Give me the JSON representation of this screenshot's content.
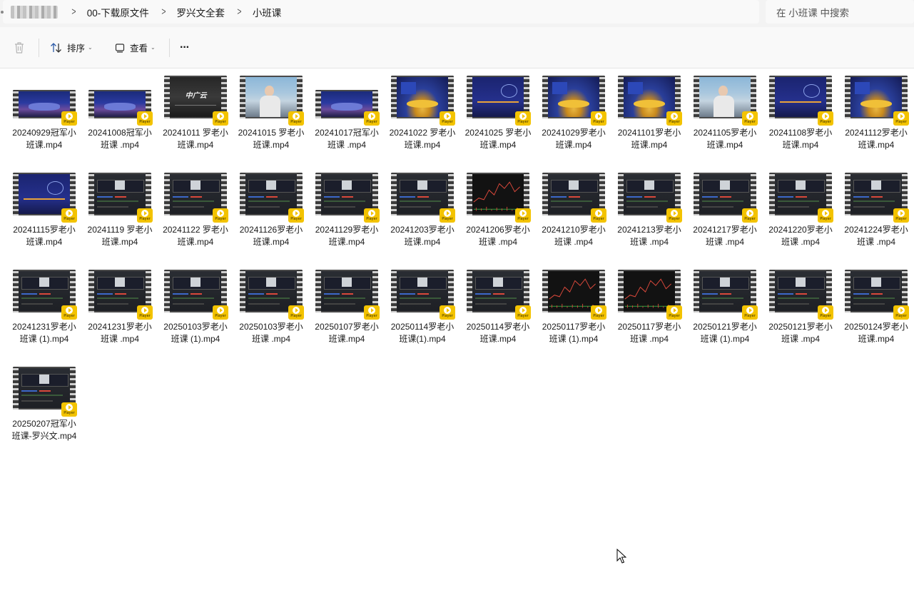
{
  "breadcrumb": {
    "items": [
      "00-下载原文件",
      "罗兴文全套",
      "小班课"
    ]
  },
  "search": {
    "placeholder": "在 小班课 中搜索"
  },
  "toolbar": {
    "sort_label": "排序",
    "view_label": "查看",
    "more_label": "···"
  },
  "badge_label": "Player",
  "files": [
    {
      "name": "20240929冠军小班课.mp4",
      "thumb": "stage"
    },
    {
      "name": "20241008冠军小班课 .mp4",
      "thumb": "stage"
    },
    {
      "name": "20241011 罗老小班课.mp4",
      "thumb": "logo"
    },
    {
      "name": "20241015 罗老小班课.mp4",
      "thumb": "person"
    },
    {
      "name": "20241017冠军小班课 .mp4",
      "thumb": "stage"
    },
    {
      "name": "20241022 罗老小班课.mp4",
      "thumb": "stage2"
    },
    {
      "name": "20241025 罗老小班课.mp4",
      "thumb": "blue"
    },
    {
      "name": "20241029罗老小班课.mp4",
      "thumb": "stage2"
    },
    {
      "name": "20241101罗老小班课.mp4",
      "thumb": "stage2"
    },
    {
      "name": "20241105罗老小班课.mp4",
      "thumb": "person"
    },
    {
      "name": "20241108罗老小班课.mp4",
      "thumb": "blue"
    },
    {
      "name": "20241112罗老小班课.mp4",
      "thumb": "stage2"
    },
    {
      "name": "20241115罗老小班课.mp4",
      "thumb": "blue"
    },
    {
      "name": "20241119 罗老小班课.mp4",
      "thumb": "screen"
    },
    {
      "name": "20241122 罗老小班课.mp4",
      "thumb": "screen"
    },
    {
      "name": "20241126罗老小班课.mp4",
      "thumb": "screen"
    },
    {
      "name": "20241129罗老小班课.mp4",
      "thumb": "screen"
    },
    {
      "name": "20241203罗老小班课.mp4",
      "thumb": "screen"
    },
    {
      "name": "20241206罗老小班课 .mp4",
      "thumb": "kline"
    },
    {
      "name": "20241210罗老小班课 .mp4",
      "thumb": "screen"
    },
    {
      "name": "20241213罗老小班课 .mp4",
      "thumb": "screen"
    },
    {
      "name": "20241217罗老小班课 .mp4",
      "thumb": "screen"
    },
    {
      "name": "20241220罗老小班课 .mp4",
      "thumb": "screen"
    },
    {
      "name": "20241224罗老小班课 .mp4",
      "thumb": "screen"
    },
    {
      "name": "20241231罗老小班课 (1).mp4",
      "thumb": "screen"
    },
    {
      "name": "20241231罗老小班课 .mp4",
      "thumb": "screen"
    },
    {
      "name": "20250103罗老小班课 (1).mp4",
      "thumb": "screen"
    },
    {
      "name": "20250103罗老小班课 .mp4",
      "thumb": "screen"
    },
    {
      "name": "20250107罗老小班课.mp4",
      "thumb": "screen"
    },
    {
      "name": "20250114罗老小班课(1).mp4",
      "thumb": "screen"
    },
    {
      "name": "20250114罗老小班课.mp4",
      "thumb": "screen"
    },
    {
      "name": "20250117罗老小班课 (1).mp4",
      "thumb": "kline"
    },
    {
      "name": "20250117罗老小班课 .mp4",
      "thumb": "kline"
    },
    {
      "name": "20250121罗老小班课 (1).mp4",
      "thumb": "screen"
    },
    {
      "name": "20250121罗老小班课 .mp4",
      "thumb": "screen"
    },
    {
      "name": "20250124罗老小班课.mp4",
      "thumb": "screen"
    },
    {
      "name": "20250207冠军小班课-罗兴文.mp4",
      "thumb": "screen"
    }
  ]
}
